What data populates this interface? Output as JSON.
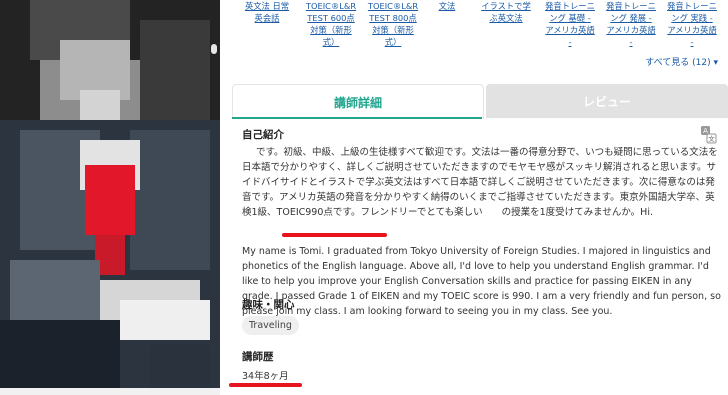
{
  "course_links": [
    "英文法 日常\n英会話",
    "TOEIC®L&R\nTEST 600点\n対策（新形\n式）",
    "TOEIC®L&R\nTEST 800点\n対策（新形\n式）",
    "文法",
    "イラストで学\nぶ英文法",
    "発音トレーニ\nング 基礎 -\nアメリカ英語\n-",
    "発音トレーニ\nング 発展 -\nアメリカ英語\n-",
    "発音トレーニ\nング 実践 -\nアメリカ英語\n-"
  ],
  "see_all": "すべて見る (12)",
  "tabs": {
    "details": "講師詳細",
    "reviews": "レビュー"
  },
  "intro": {
    "title": "自己紹介",
    "japanese": "です。初級、中級、上級の生徒様すべて歓迎です。文法は一番の得意分野で、いつも疑問に思っている文法を日本語で分かりやすく、詳しくご説明させていただきますのでモヤモヤ感がスッキリ解消されると思います。サイドバイサイドとイラストで学ぶ英文法はすべて日本語で詳しくご説明させていただきます。次に得意なのは発音です。アメリカ英語の発音を分かりやすく納得のいくまでご指導させていただきます。東京外国語大学卒、英検1級、TOEIC990点です。フレンドリーでとても楽しい　　の授業を1度受けてみませんか。Hi.",
    "english": "My name is Tomi. I graduated from Tokyo University of Foreign Studies. I majored in linguistics and phonetics of the English language. Above all, I'd love to help you understand English grammar. I'd like to help you improve your English Conversation skills and practice for passing EIKEN in any grade. I passed Grade 1 of EIKEN and my TOEIC score is 990. I am a very friendly and fun person, so please join my class. I am looking forward to seeing you in my class. See you."
  },
  "hobbies": {
    "title": "趣味・関心",
    "tag": "Traveling"
  },
  "teaching_history": {
    "title": "講師歴",
    "value": "34年8ヶ月"
  },
  "colors": {
    "accent": "#21a58e",
    "link": "#1a5aa6",
    "highlight": "#e8141d"
  }
}
